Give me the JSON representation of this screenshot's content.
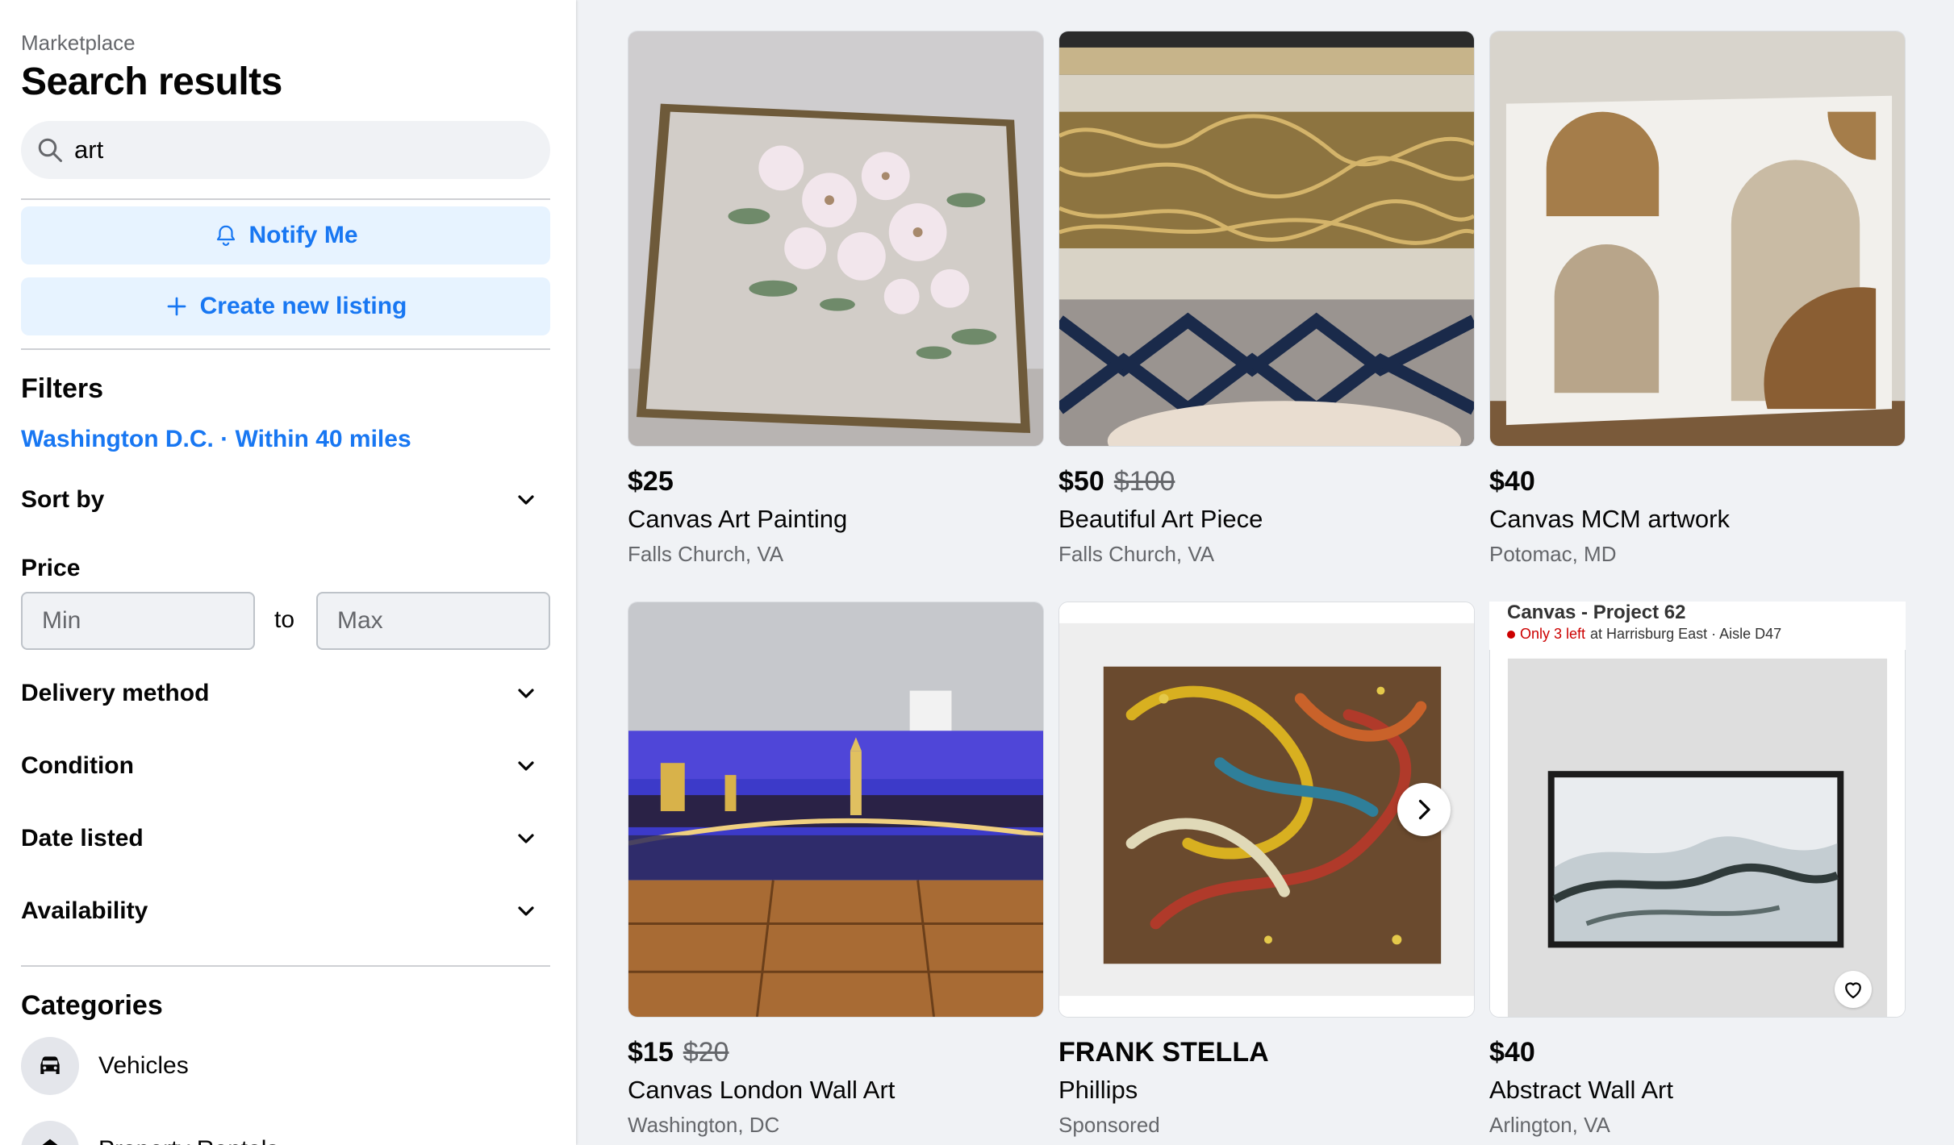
{
  "sidebar": {
    "breadcrumb": "Marketplace",
    "title": "Search results",
    "search": {
      "value": "art"
    },
    "notify_label": "Notify Me",
    "create_label": "Create new listing",
    "filters_title": "Filters",
    "location": "Washington D.C. · Within 40 miles",
    "sort_label": "Sort by",
    "price_label": "Price",
    "price_min_placeholder": "Min",
    "price_max_placeholder": "Max",
    "price_to": "to",
    "filters": [
      "Delivery method",
      "Condition",
      "Date listed",
      "Availability"
    ],
    "categories_title": "Categories",
    "categories": [
      {
        "label": "Vehicles",
        "icon": "car-icon"
      },
      {
        "label": "Property Rentals",
        "icon": "home-icon"
      }
    ]
  },
  "listings": [
    {
      "price": "$25",
      "old_price": "",
      "title": "Canvas Art Painting",
      "location": "Falls Church, VA"
    },
    {
      "price": "$50",
      "old_price": "$100",
      "title": "Beautiful Art Piece",
      "location": "Falls Church, VA"
    },
    {
      "price": "$40",
      "old_price": "",
      "title": "Canvas MCM artwork",
      "location": "Potomac, MD"
    },
    {
      "price": "$15",
      "old_price": "$20",
      "title": "Canvas London Wall Art",
      "location": "Washington, DC"
    },
    {
      "price": "FRANK STELLA",
      "old_price": "",
      "title": "Phillips",
      "location": "Sponsored"
    },
    {
      "price": "$40",
      "old_price": "",
      "title": "Abstract Wall Art",
      "location": "Arlington, VA"
    }
  ],
  "target_banner": {
    "line1": "Canvas - Project 62",
    "stock": "Only 3 left",
    "store": "at Harrisburg East · Aisle D47"
  },
  "colors": {
    "accent": "#1877f2",
    "accent_bg": "#e7f3ff",
    "muted": "#65676b"
  }
}
